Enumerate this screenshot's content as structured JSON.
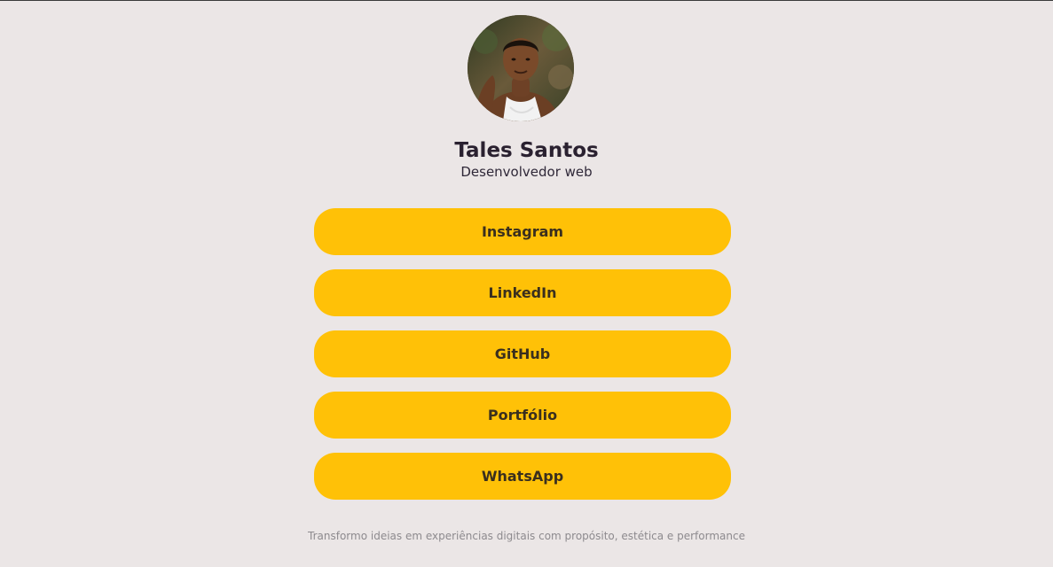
{
  "profile": {
    "name": "Tales Santos",
    "role": "Desenvolvedor web",
    "avatar_icon": "profile-photo"
  },
  "links": [
    {
      "label": "Instagram"
    },
    {
      "label": "LinkedIn"
    },
    {
      "label": "GitHub"
    },
    {
      "label": "Portfólio"
    },
    {
      "label": "WhatsApp"
    }
  ],
  "footer": {
    "tagline": "Transformo ideias em experiências digitais com propósito, estética e performance"
  },
  "colors": {
    "background": "#ebe6e6",
    "button": "#ffc107",
    "text": "#2a2130"
  }
}
